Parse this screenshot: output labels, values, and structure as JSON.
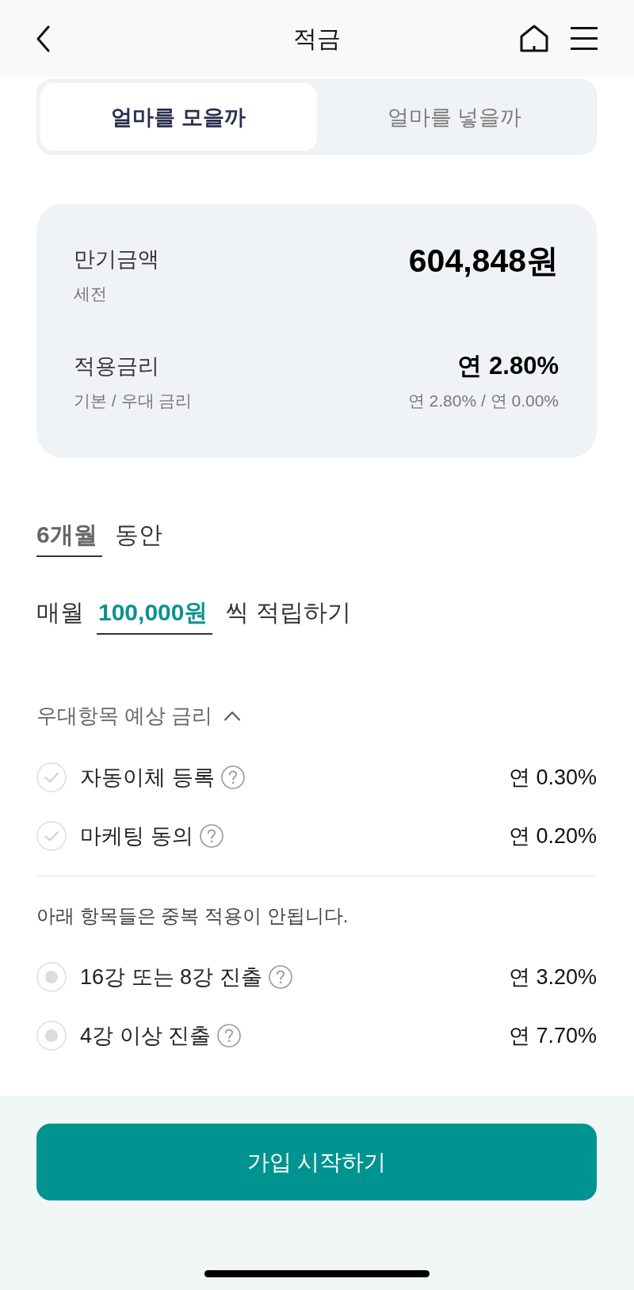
{
  "header": {
    "title": "적금"
  },
  "tabs": [
    {
      "label": "얼마를 모을까",
      "selected": true
    },
    {
      "label": "얼마를 넣을까",
      "selected": false
    }
  ],
  "summary": [
    {
      "label": "만기금액",
      "sublabel": "세전",
      "value": "604,848원"
    },
    {
      "label": "적용금리",
      "sublabel": "기본 / 우대 금리",
      "value": "연 2.80%",
      "detail": "연 2.80% / 연 0.00%"
    }
  ],
  "period": {
    "value": "6개월",
    "suffix": "동안"
  },
  "monthly": {
    "prefix": "매월",
    "value": "100,000원",
    "suffix": "씩 적립하기"
  },
  "preferences": {
    "title": "우대항목 예상 금리",
    "expanded": true,
    "options": [
      {
        "label": "자동이체 등록",
        "rate": "연 0.30%",
        "checked": false
      },
      {
        "label": "마케팅 동의",
        "rate": "연 0.20%",
        "checked": false
      }
    ],
    "notice": "아래 항목들은 중복 적용이 안됩니다.",
    "exclusive_options": [
      {
        "label": "16강 또는 8강 진출",
        "rate": "연 3.20%",
        "selected": false
      },
      {
        "label": "4강 이상 진출",
        "rate": "연 7.70%",
        "selected": false
      }
    ]
  },
  "primary_button": {
    "label": "가입 시작하기"
  }
}
